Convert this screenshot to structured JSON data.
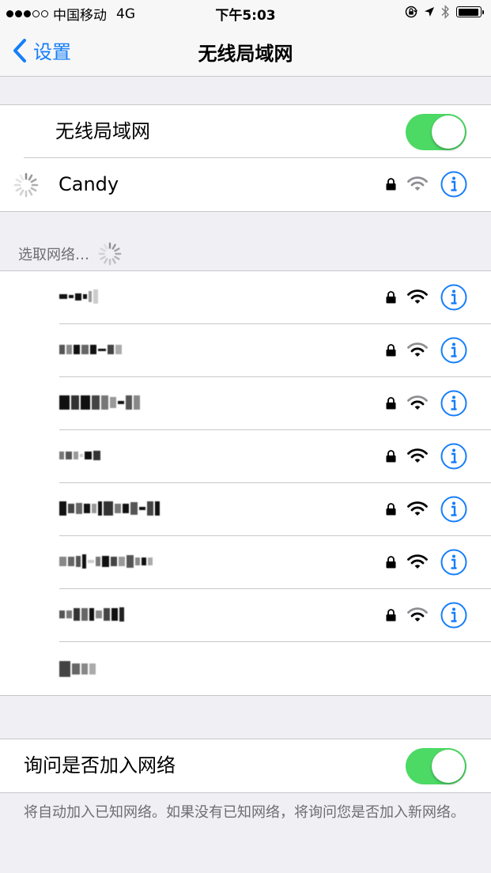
{
  "status_bar": {
    "carrier": "中国移动",
    "network": "4G",
    "time": "下午5:03",
    "signal_dots": [
      true,
      true,
      true,
      false,
      false
    ],
    "battery_level": 0.95
  },
  "nav": {
    "back_label": "设置",
    "title": "无线局域网"
  },
  "wifi_toggle": {
    "label": "无线局域网",
    "on": true
  },
  "connected": {
    "name": "Candy",
    "secured": true,
    "signal": "weak",
    "status": "connecting"
  },
  "networks_header": "选取网络…",
  "networks": [
    {
      "name_hidden": true,
      "secured": true,
      "signal": "strong"
    },
    {
      "name_hidden": true,
      "secured": true,
      "signal": "medium"
    },
    {
      "name_hidden": true,
      "secured": true,
      "signal": "medium"
    },
    {
      "name_hidden": true,
      "secured": true,
      "signal": "strong"
    },
    {
      "name_hidden": true,
      "secured": true,
      "signal": "strong"
    },
    {
      "name_hidden": true,
      "secured": true,
      "signal": "strong"
    },
    {
      "name_hidden": true,
      "secured": true,
      "signal": "medium"
    },
    {
      "name_hidden": true,
      "secured": false,
      "signal": "none",
      "other": true
    }
  ],
  "ask_to_join": {
    "label": "询问是否加入网络",
    "on": true
  },
  "footer": "将自动加入已知网络。如果没有已知网络，将询问您是否加入新网络。",
  "colors": {
    "accent": "#157efb",
    "toggle_on": "#4cd964",
    "background": "#efeff4",
    "separator": "#c8c7cc"
  },
  "icons": {
    "back": "chevron-left-icon",
    "lock": "lock-icon",
    "wifi": "wifi-icon",
    "info": "info-icon",
    "spinner": "spinner-icon",
    "location": "location-arrow-icon",
    "bluetooth": "bluetooth-icon",
    "rotation_lock": "rotation-lock-icon"
  }
}
